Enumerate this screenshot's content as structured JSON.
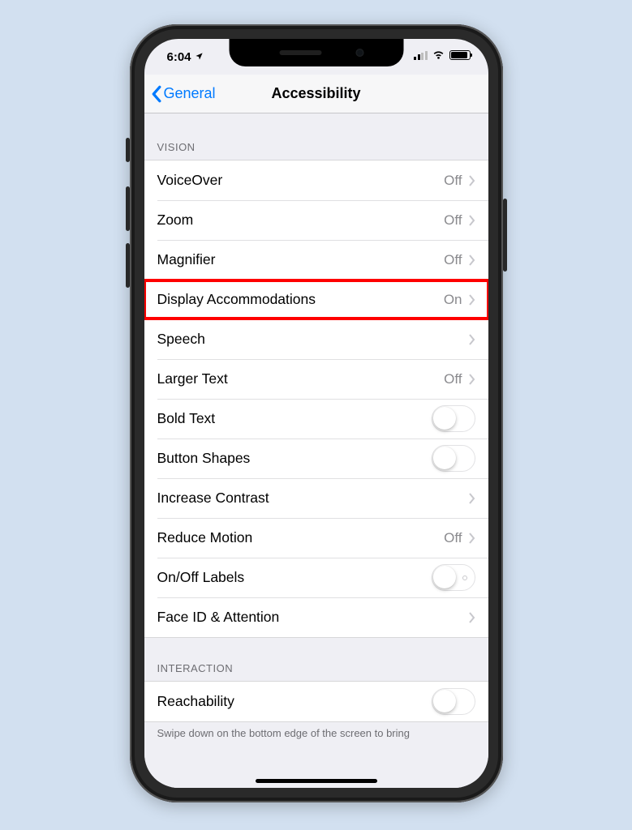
{
  "status": {
    "time": "6:04",
    "location_services": true,
    "signal_bars_active": 2,
    "signal_bars_total": 4
  },
  "nav": {
    "back_label": "General",
    "title": "Accessibility"
  },
  "sections": {
    "vision_header": "VISION",
    "interaction_header": "INTERACTION"
  },
  "rows": {
    "voiceover": {
      "label": "VoiceOver",
      "value": "Off"
    },
    "zoom": {
      "label": "Zoom",
      "value": "Off"
    },
    "magnifier": {
      "label": "Magnifier",
      "value": "Off"
    },
    "display": {
      "label": "Display Accommodations",
      "value": "On"
    },
    "speech": {
      "label": "Speech"
    },
    "largertext": {
      "label": "Larger Text",
      "value": "Off"
    },
    "boldtext": {
      "label": "Bold Text"
    },
    "buttonshapes": {
      "label": "Button Shapes"
    },
    "contrast": {
      "label": "Increase Contrast"
    },
    "reducemotion": {
      "label": "Reduce Motion",
      "value": "Off"
    },
    "onofflabels": {
      "label": "On/Off Labels"
    },
    "faceid": {
      "label": "Face ID & Attention"
    },
    "reachability": {
      "label": "Reachability"
    }
  },
  "footer": {
    "reachability_note": "Swipe down on the bottom edge of the screen to bring"
  }
}
